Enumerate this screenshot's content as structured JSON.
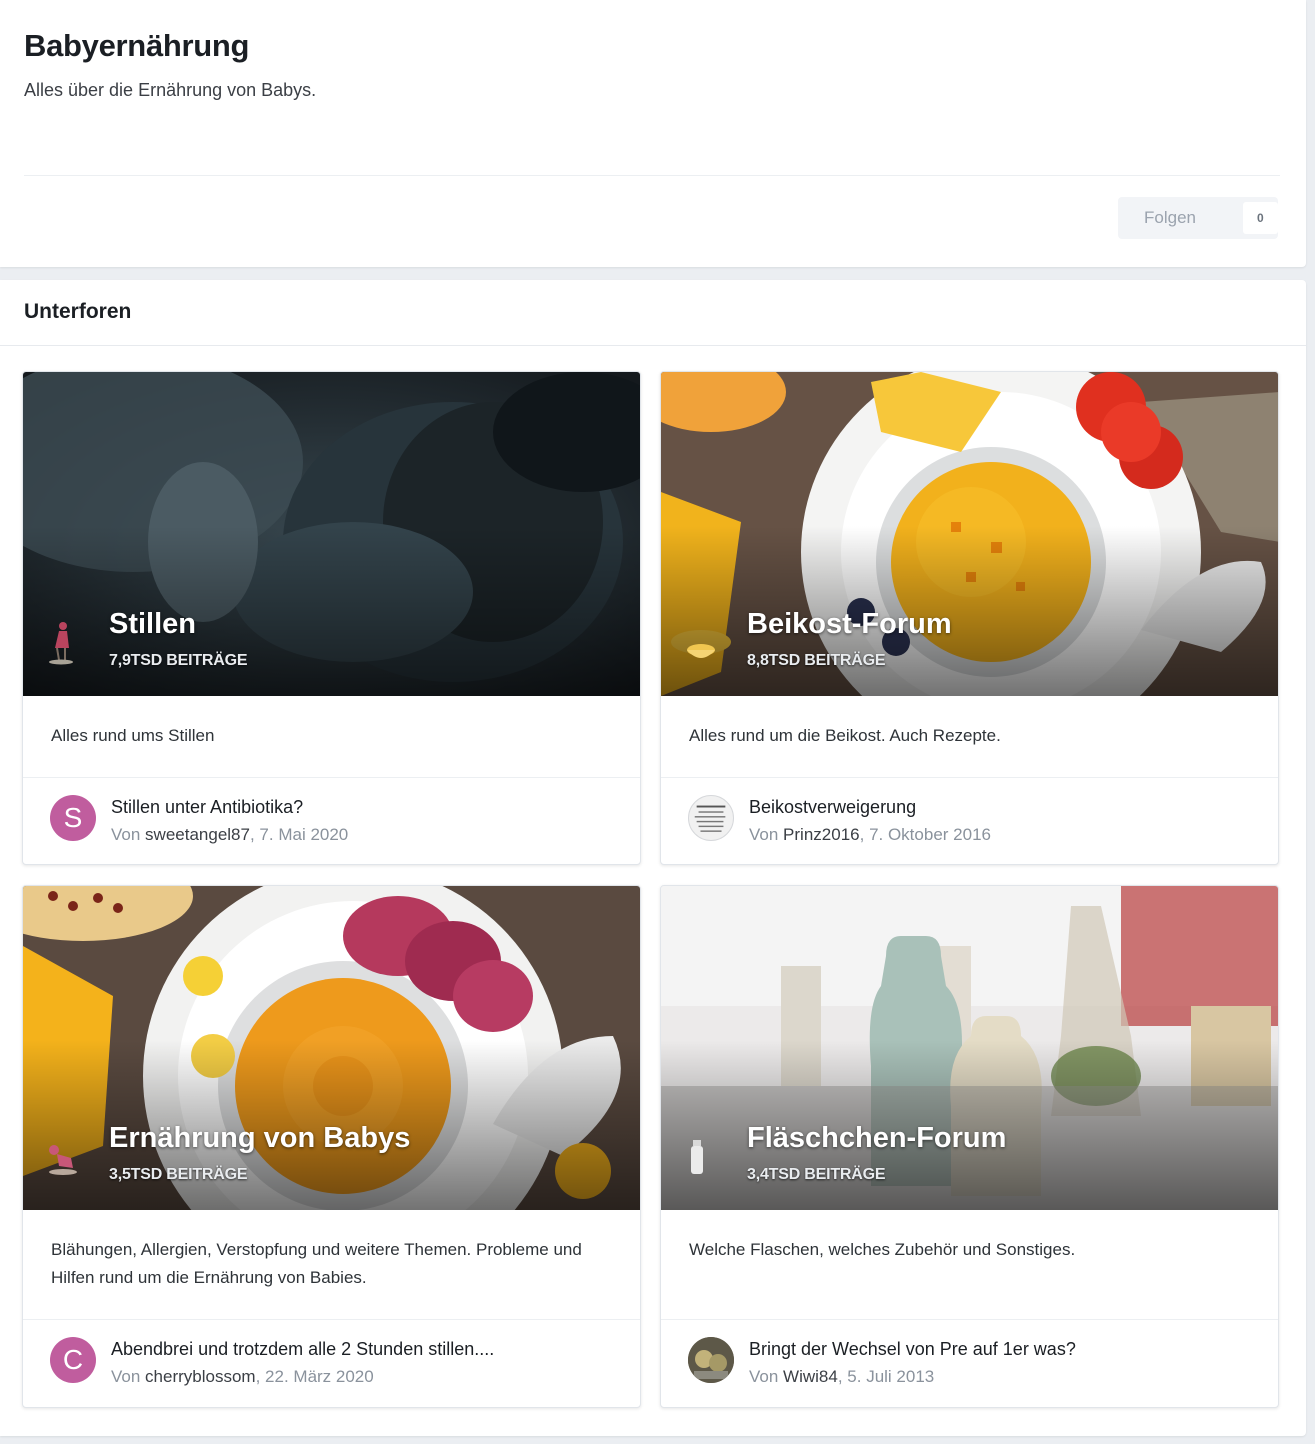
{
  "header": {
    "title": "Babyernährung",
    "subtitle": "Alles über die Ernährung von Babys.",
    "follow_label": "Folgen",
    "follow_count": "0"
  },
  "section": {
    "title": "Unterforen"
  },
  "colors": {
    "avatar_pink": "#c05d9e",
    "accent": "#1b1f24",
    "muted": "#8a929c"
  },
  "forums": [
    {
      "name": "Stillen",
      "posts": "7,9TSD BEITRÄGE",
      "description": "Alles rund ums Stillen",
      "last_topic": "Stillen unter Antibiotika?",
      "by_label": "Von ",
      "author": "sweetangel87",
      "date": "7. Mai 2020",
      "avatar_letter": "S",
      "icon": "breastfeeding-mother-icon"
    },
    {
      "name": "Beikost-Forum",
      "posts": "8,8TSD BEITRÄGE",
      "description": "Alles rund um die Beikost. Auch Rezepte.",
      "last_topic": "Beikostverweigerung",
      "by_label": "Von ",
      "author": "Prinz2016",
      "date": "7. Oktober 2016",
      "avatar_letter": "",
      "icon": "bowl-icon"
    },
    {
      "name": "Ernährung von Babys",
      "posts": "3,5TSD BEITRÄGE",
      "description": "Blähungen, Allergien, Verstopfung und weitere Themen. Probleme und Hilfen rund um die Ernährung von Babies.",
      "last_topic": "Abendbrei und trotzdem alle 2 Stunden stillen....",
      "by_label": "Von ",
      "author": "cherryblossom",
      "date": "22. März 2020",
      "avatar_letter": "C",
      "icon": "crawling-baby-icon"
    },
    {
      "name": "Fläschchen-Forum",
      "posts": "3,4TSD BEITRÄGE",
      "description": "Welche Flaschen, welches Zubehör und Sonstiges.",
      "last_topic": "Bringt der Wechsel von Pre auf 1er was?",
      "by_label": "Von ",
      "author": "Wiwi84",
      "date": "5. Juli 2013",
      "avatar_letter": "",
      "icon": "bottle-icon"
    }
  ]
}
